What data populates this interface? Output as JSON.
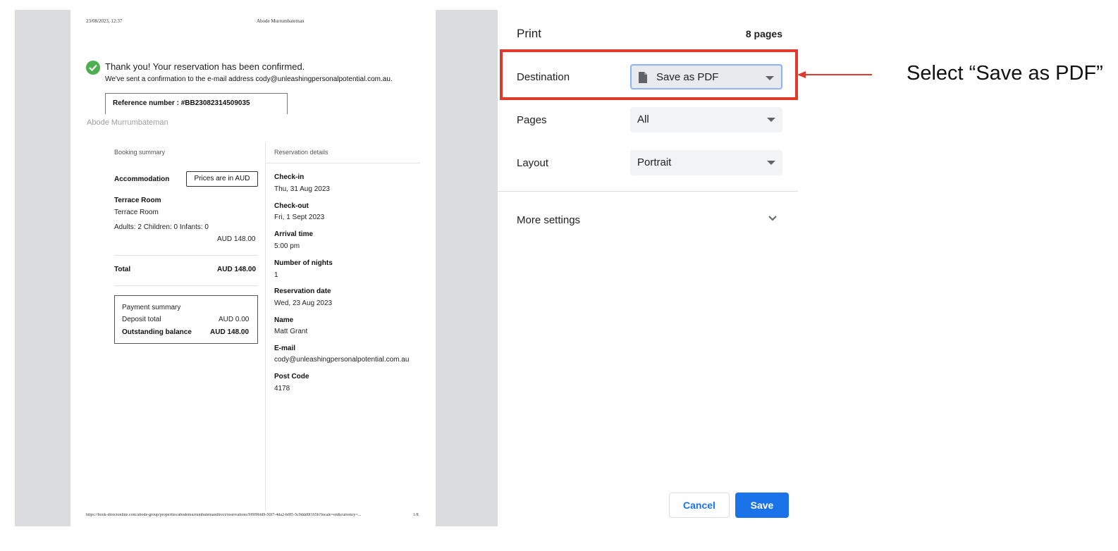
{
  "preview": {
    "header_datetime": "23/08/2023, 12:37",
    "header_title": "Abode Murrumbateman",
    "confirmation_title": "Thank you! Your reservation has been confirmed.",
    "confirmation_sent": "We've sent a confirmation to the e-mail address cody@unleashingpersonalpotential.com.au.",
    "reference": "Reference number : #BB23082314509035",
    "hotel_name": "Abode Murrumbateman",
    "booking_summary": {
      "heading": "Booking summary",
      "accommodation_label": "Accommodation",
      "prices_button": "Prices are in AUD",
      "room_name": "Terrace Room",
      "room_type": "Terrace Room",
      "guests": "Adults: 2  Children: 0  Infants: 0",
      "room_price": "AUD 148.00",
      "total_label": "Total",
      "total_value": "AUD 148.00",
      "payment_heading": "Payment summary",
      "deposit_label": "Deposit total",
      "deposit_value": "AUD 0.00",
      "outstanding_label": "Outstanding balance",
      "outstanding_value": "AUD 148.00"
    },
    "reservation_details": {
      "heading": "Reservation details",
      "items": [
        {
          "label": "Check-in",
          "value": "Thu, 31 Aug 2023"
        },
        {
          "label": "Check-out",
          "value": "Fri, 1 Sept 2023"
        },
        {
          "label": "Arrival time",
          "value": "5:00 pm"
        },
        {
          "label": "Number of nights",
          "value": "1"
        },
        {
          "label": "Reservation date",
          "value": "Wed, 23 Aug 2023"
        },
        {
          "label": "Name",
          "value": "Matt Grant"
        },
        {
          "label": "E-mail",
          "value": "cody@unleashingpersonalpotential.com.au"
        },
        {
          "label": "Post Code",
          "value": "4178"
        }
      ]
    },
    "footer_url": "https://book-directonline.com/abode-group/properties/abodemurrumbatemandirect/reservations/9f9f9bfd9-50f7-4da2-bf85-5c9ddd0f165b?locale=en&currency=...",
    "footer_page": "1/8"
  },
  "print_panel": {
    "title": "Print",
    "page_count": "8 pages",
    "destination_label": "Destination",
    "destination_value": "Save as PDF",
    "pages_label": "Pages",
    "pages_value": "All",
    "layout_label": "Layout",
    "layout_value": "Portrait",
    "more_settings": "More settings",
    "cancel": "Cancel",
    "save": "Save"
  },
  "annotation": {
    "callout_text": "Select “Save as PDF”",
    "highlight_color": "#e03a2c"
  },
  "colors": {
    "accent": "#1a73e8",
    "check_green": "#4caf50",
    "preview_bg": "#dadce0"
  }
}
